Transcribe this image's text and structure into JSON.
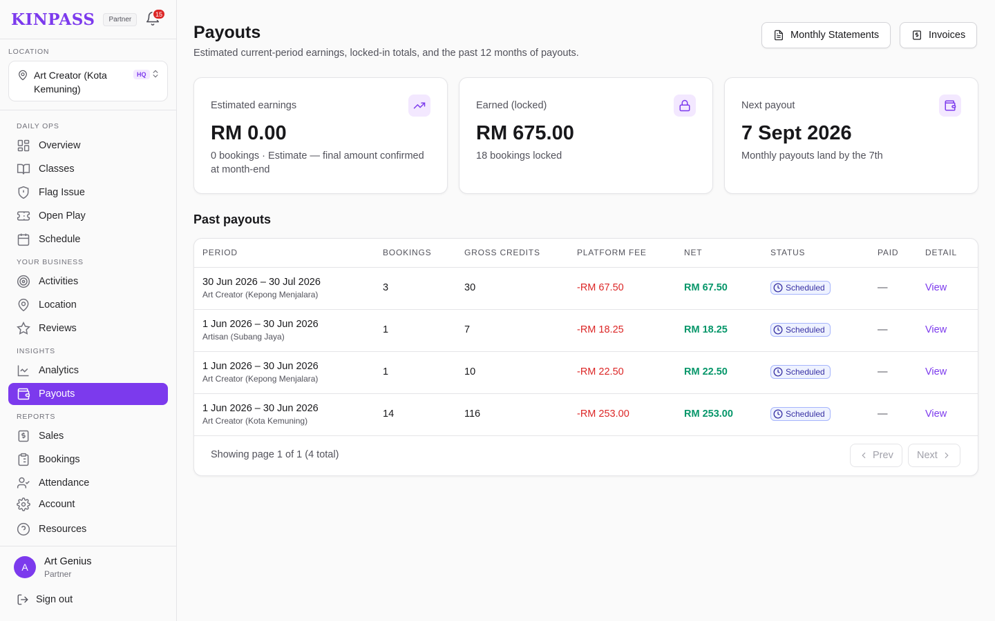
{
  "brand": {
    "logo": "KINPASS",
    "badge": "Partner",
    "notifications": "15"
  },
  "location": {
    "label": "LOCATION",
    "name": "Art Creator (Kota Kemuning)",
    "badge": "HQ"
  },
  "sidebar": {
    "sections": {
      "daily_ops": "DAILY OPS",
      "your_business": "YOUR BUSINESS",
      "insights": "INSIGHTS",
      "reports": "REPORTS"
    },
    "items": {
      "overview": "Overview",
      "classes": "Classes",
      "flag_issue": "Flag Issue",
      "open_play": "Open Play",
      "schedule": "Schedule",
      "activities": "Activities",
      "location": "Location",
      "reviews": "Reviews",
      "analytics": "Analytics",
      "payouts": "Payouts",
      "sales": "Sales",
      "bookings": "Bookings",
      "attendance": "Attendance",
      "account": "Account",
      "resources": "Resources"
    },
    "active": "payouts"
  },
  "user": {
    "initial": "A",
    "name": "Art Genius",
    "role": "Partner",
    "signout": "Sign out"
  },
  "header": {
    "title": "Payouts",
    "subtitle": "Estimated current-period earnings, locked-in totals, and the past 12 months of payouts.",
    "btn_statements": "Monthly Statements",
    "btn_invoices": "Invoices"
  },
  "stats": {
    "estimated": {
      "label": "Estimated earnings",
      "value": "RM 0.00",
      "desc": "0 bookings · Estimate — final amount confirmed at month-end"
    },
    "locked": {
      "label": "Earned (locked)",
      "value": "RM 675.00",
      "desc": "18 bookings locked"
    },
    "next": {
      "label": "Next payout",
      "value": "7 Sept 2026",
      "desc": "Monthly payouts land by the 7th"
    }
  },
  "table": {
    "title": "Past payouts",
    "headers": {
      "period": "PERIOD",
      "bookings": "BOOKINGS",
      "gross": "GROSS CREDITS",
      "fee": "PLATFORM FEE",
      "net": "NET",
      "status": "STATUS",
      "paid": "PAID",
      "detail": "DETAIL"
    },
    "rows": [
      {
        "period": "30 Jun 2026 – 30 Jul 2026",
        "location": "Art Creator (Kepong Menjalara)",
        "bookings": "3",
        "gross": "30",
        "fee": "-RM 67.50",
        "net": "RM 67.50",
        "status": "Scheduled",
        "paid": "—",
        "detail": "View"
      },
      {
        "period": "1 Jun 2026 – 30 Jun 2026",
        "location": "Artisan (Subang Jaya)",
        "bookings": "1",
        "gross": "7",
        "fee": "-RM 18.25",
        "net": "RM 18.25",
        "status": "Scheduled",
        "paid": "—",
        "detail": "View"
      },
      {
        "period": "1 Jun 2026 – 30 Jun 2026",
        "location": "Art Creator (Kepong Menjalara)",
        "bookings": "1",
        "gross": "10",
        "fee": "-RM 22.50",
        "net": "RM 22.50",
        "status": "Scheduled",
        "paid": "—",
        "detail": "View"
      },
      {
        "period": "1 Jun 2026 – 30 Jun 2026",
        "location": "Art Creator (Kota Kemuning)",
        "bookings": "14",
        "gross": "116",
        "fee": "-RM 253.00",
        "net": "RM 253.00",
        "status": "Scheduled",
        "paid": "—",
        "detail": "View"
      }
    ],
    "footer": "Showing page 1 of 1 (4 total)",
    "prev": "Prev",
    "next": "Next"
  },
  "colors": {
    "accent": "#7c3aed",
    "danger": "#dc2626",
    "success": "#059669"
  }
}
